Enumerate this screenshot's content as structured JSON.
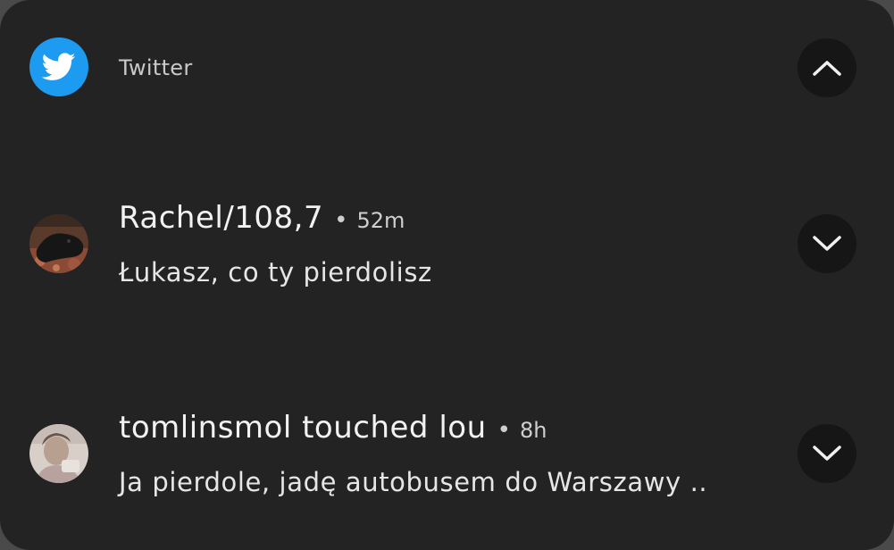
{
  "app": {
    "name": "Twitter",
    "icon": "twitter-bird-icon",
    "accent": "#1d9bf0",
    "collapse_icon": "chevron-up-icon"
  },
  "notifications": [
    {
      "sender": "Rachel/108,7",
      "separator": "•",
      "time": "52m",
      "message": "Łukasz, co ty pierdolisz",
      "expand_icon": "chevron-down-icon"
    },
    {
      "sender": "tomlinsmol touched lou",
      "separator": "•",
      "time": "8h",
      "message": "Ja pierdole, jadę autobusem do Warszawy ..",
      "expand_icon": "chevron-down-icon"
    }
  ]
}
